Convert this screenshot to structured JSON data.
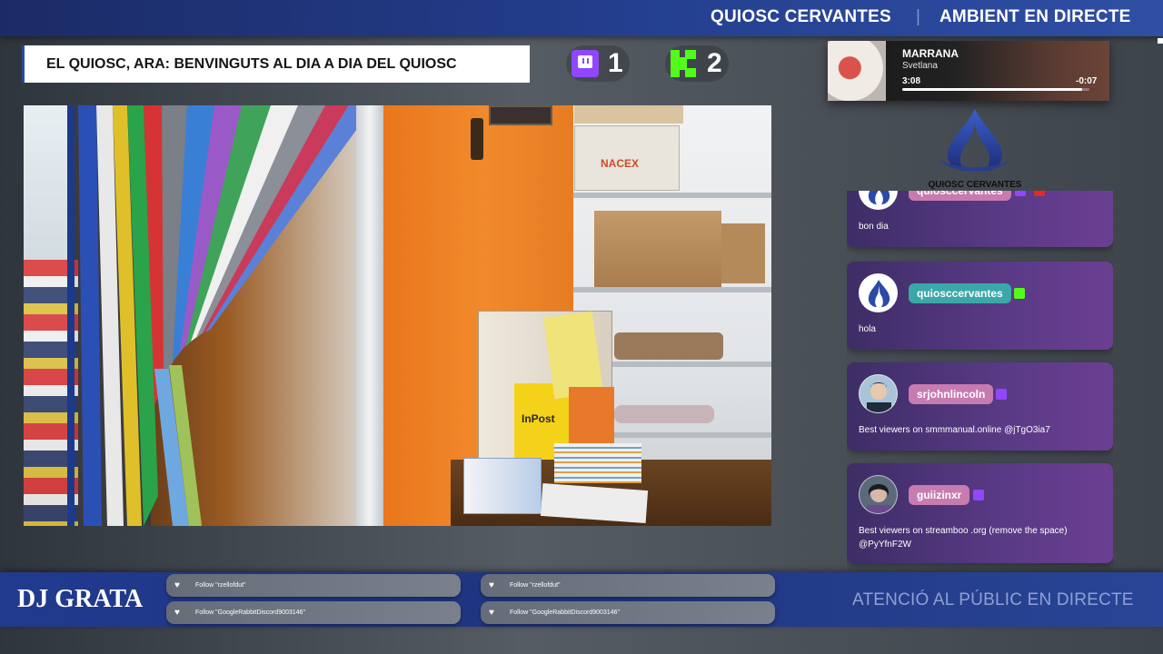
{
  "header": {
    "brand_left": "QUIOSC CERVANTES",
    "separator": "|",
    "brand_right": "AMBIENT EN DIRECTE"
  },
  "stream_title": "EL QUIOSC, ARA: BENVINGUTS AL DIA A DIA DEL QUIOSC",
  "viewers": {
    "twitch": {
      "icon": "twitch-icon",
      "count": "1",
      "color": "#9146ff"
    },
    "kick": {
      "icon": "kick-icon",
      "count": "2",
      "color": "#53fc18"
    }
  },
  "now_playing": {
    "track": "MARRANA",
    "artist": "Svetlana",
    "elapsed": "3:08",
    "remaining": "-0:07",
    "progress": 0.96
  },
  "logo": {
    "text": "QUIOSC CERVANTES"
  },
  "chat": {
    "messages": [
      {
        "username": "quiosccervantes",
        "text": "bon dia",
        "name_color": "#c77bb0",
        "badges": [
          "twitch-badge",
          "youtube-badge"
        ]
      },
      {
        "username": "quiosccervantes",
        "text": "hola",
        "name_color": "#3aa8a8",
        "badges": [
          "kick-badge"
        ]
      },
      {
        "username": "srjohnlincoln",
        "text": "Best viewers on smmmanual.online @jTgO3ia7",
        "name_color": "#c77bb0",
        "badges": [
          "twitch-badge"
        ]
      },
      {
        "username": "guiizinxr",
        "text": "Best viewers on streamboo .org (remove the space) @PyYfnF2W",
        "name_color": "#c77bb0",
        "badges": [
          "twitch-badge"
        ]
      }
    ]
  },
  "footer": {
    "dj": "DJ GRATA",
    "follows": [
      "Follow \"rzellofdut\"",
      "Follow \"GoogleRabbitDiscord9003146\"",
      "Follow \"rzellofdut\"",
      "Follow \"GoogleRabbitDiscord9003146\""
    ],
    "ticker": "ATENCIÓ AL PÚBLIC EN DIRECTE"
  }
}
